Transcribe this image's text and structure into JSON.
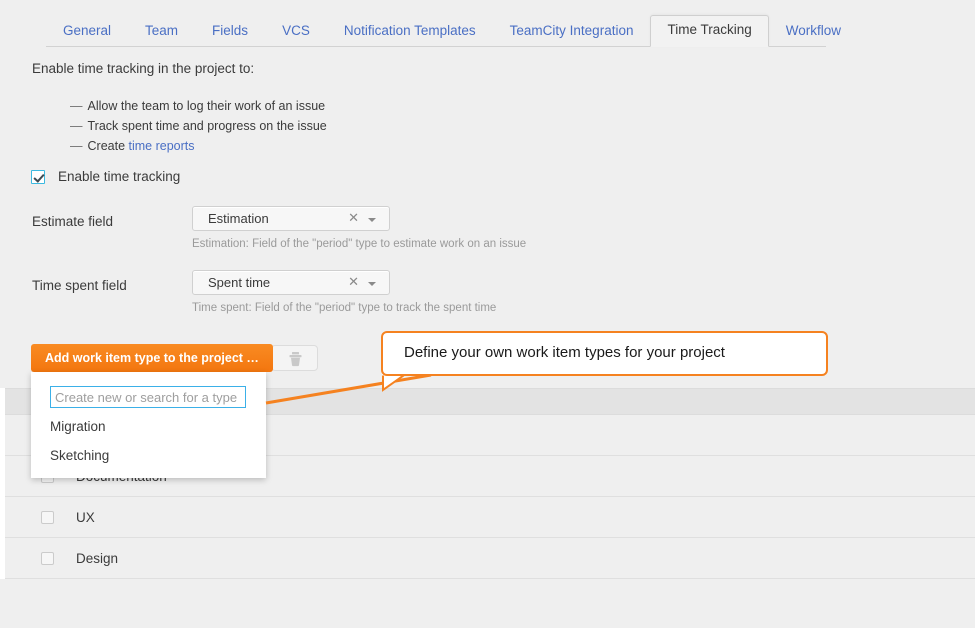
{
  "tabs": [
    {
      "label": "General",
      "active": false
    },
    {
      "label": "Team",
      "active": false
    },
    {
      "label": "Fields",
      "active": false
    },
    {
      "label": "VCS",
      "active": false
    },
    {
      "label": "Notification Templates",
      "active": false
    },
    {
      "label": "TeamCity Integration",
      "active": false
    },
    {
      "label": "Time Tracking",
      "active": true
    },
    {
      "label": "Workflow",
      "active": false
    }
  ],
  "intro": {
    "lead": "Enable time tracking in the project to:",
    "bullets": [
      {
        "dash": "—",
        "text": "Allow the team to log their work of an issue",
        "link": null
      },
      {
        "dash": "—",
        "text": "Track spent time and progress on the issue",
        "link": null
      },
      {
        "dash": "—",
        "text": "Create ",
        "link": "time reports"
      }
    ]
  },
  "enable": {
    "label": "Enable time tracking",
    "checked": true
  },
  "fields": [
    {
      "label": "Estimate field",
      "value": "Estimation",
      "clear_glyph": "✕",
      "hint": "Estimation: Field of the \"period\" type to estimate work on an issue"
    },
    {
      "label": "Time spent field",
      "value": "Spent time",
      "clear_glyph": "✕",
      "hint": "Time spent: Field of the \"period\" type to track the spent time"
    }
  ],
  "toolbar": {
    "add_button_label": "Add work item type to the project …",
    "delete_button_icon": "trash-icon"
  },
  "dropdown": {
    "search_placeholder": "Create new or search for a type",
    "search_value": "",
    "items": [
      "Migration",
      "Sketching"
    ]
  },
  "callout": {
    "text": "Define your own work item types for your project",
    "border_color": "#f58220"
  },
  "table": {
    "header_columns": [],
    "rows": [
      {
        "label": "",
        "checked": false
      },
      {
        "label": "Documentation",
        "checked": false
      },
      {
        "label": "UX",
        "checked": false
      },
      {
        "label": "Design",
        "checked": false
      }
    ]
  },
  "colors": {
    "accent_orange": "#f3760f",
    "link_blue": "#4a6fc4",
    "checkbox_cyan": "#3bb9e0",
    "page_bg": "#efefef"
  }
}
